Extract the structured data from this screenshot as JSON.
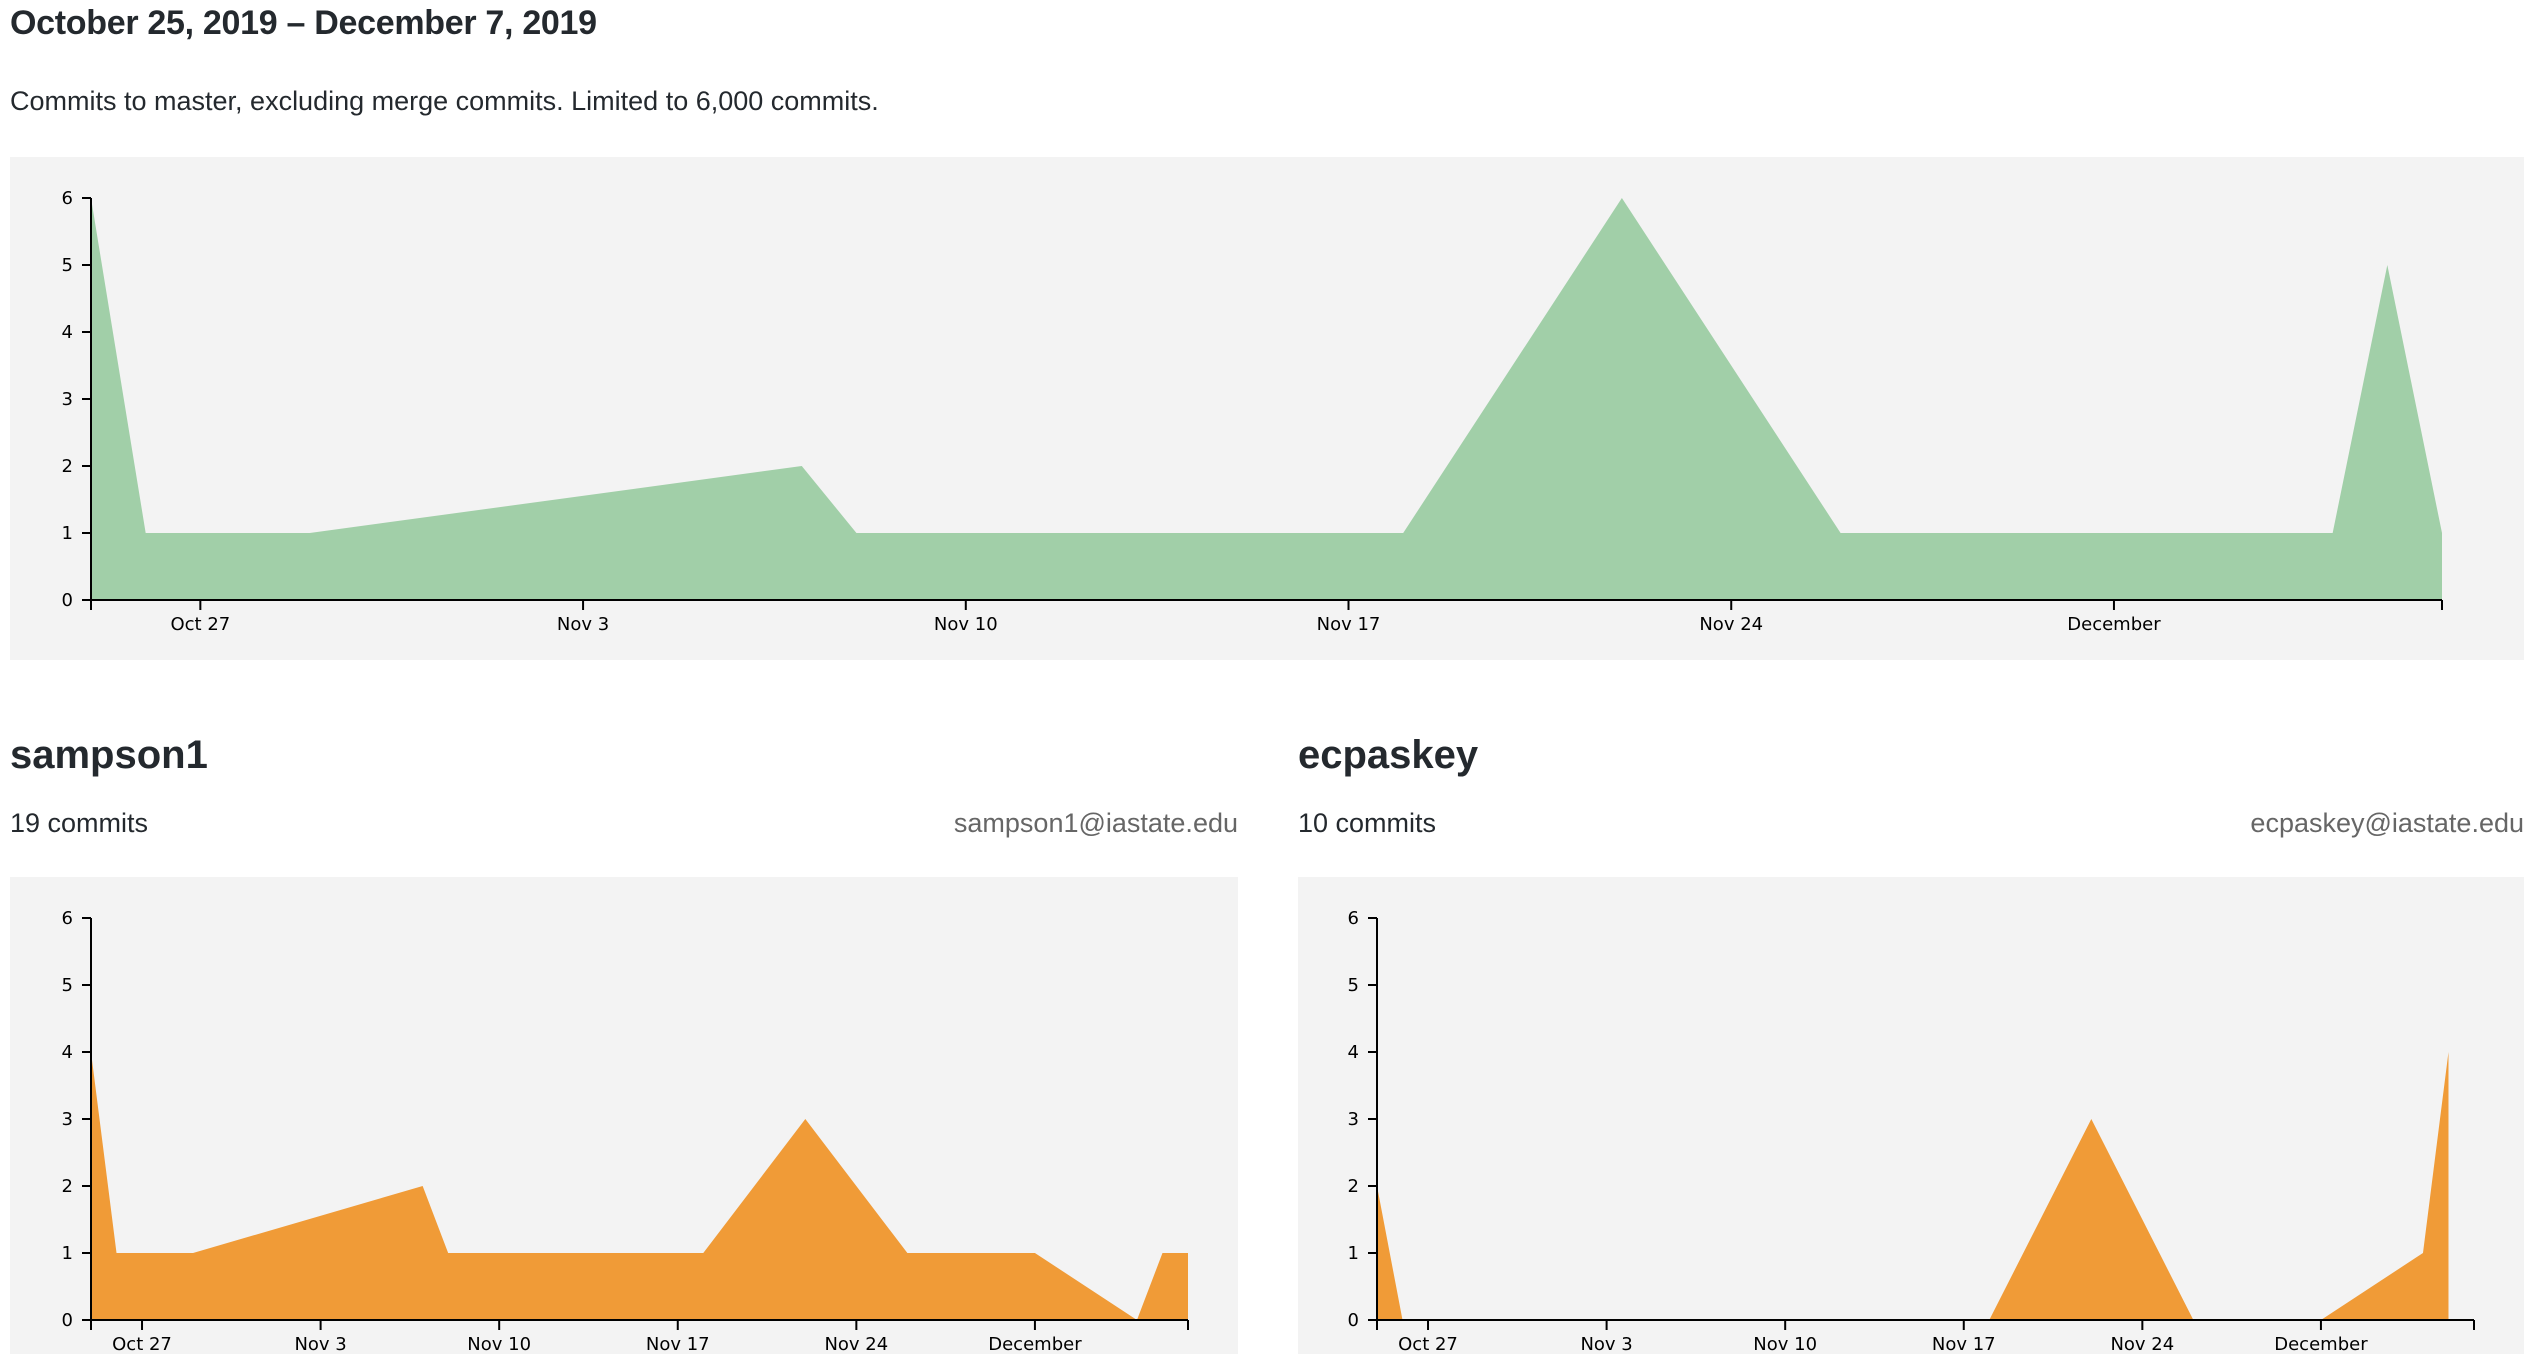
{
  "header": {
    "range_title": "October 25, 2019 – December 7, 2019",
    "description": "Commits to master, excluding merge commits. Limited to 6,000 commits."
  },
  "colors": {
    "main_area": "#a1cfa8",
    "contributor_area": "#f09b37",
    "panel_bg": "#f3f3f3",
    "email": "#666666"
  },
  "contributors": [
    {
      "name": "sampson1",
      "commits": "19 commits",
      "email": "sampson1@iastate.edu"
    },
    {
      "name": "ecpaskey",
      "commits": "10 commits",
      "email": "ecpaskey@iastate.edu"
    }
  ],
  "chart_data": [
    {
      "type": "area",
      "title": "",
      "x_tick_labels": [
        "Oct 27",
        "Nov 3",
        "Nov 10",
        "Nov 17",
        "Nov 24",
        "December"
      ],
      "x_tick_dates": [
        "2019-10-27",
        "2019-11-03",
        "2019-11-10",
        "2019-11-17",
        "2019-11-24",
        "2019-12-01"
      ],
      "xlim": [
        "2019-10-25",
        "2019-12-07"
      ],
      "ylim": [
        0,
        6
      ],
      "y_ticks": [
        0,
        1,
        2,
        3,
        4,
        5,
        6
      ],
      "grid": false,
      "series": [
        {
          "x": [
            "2019-10-25",
            "2019-10-26",
            "2019-10-29",
            "2019-11-07",
            "2019-11-08",
            "2019-11-18",
            "2019-11-22",
            "2019-11-26",
            "2019-12-05",
            "2019-12-06",
            "2019-12-07"
          ],
          "y": [
            6,
            1,
            1,
            2,
            1,
            1,
            6,
            1,
            1,
            5,
            1
          ]
        }
      ]
    },
    {
      "type": "area",
      "title": "",
      "x_tick_labels": [
        "Oct 27",
        "Nov 3",
        "Nov 10",
        "Nov 17",
        "Nov 24",
        "December"
      ],
      "x_tick_dates": [
        "2019-10-27",
        "2019-11-03",
        "2019-11-10",
        "2019-11-17",
        "2019-11-24",
        "2019-12-01"
      ],
      "xlim": [
        "2019-10-25",
        "2019-12-07"
      ],
      "ylim": [
        0,
        6
      ],
      "y_ticks": [
        0,
        1,
        2,
        3,
        4,
        5,
        6
      ],
      "grid": false,
      "series": [
        {
          "x": [
            "2019-10-25",
            "2019-10-26",
            "2019-10-29",
            "2019-11-07",
            "2019-11-08",
            "2019-11-18",
            "2019-11-22",
            "2019-11-26",
            "2019-12-01",
            "2019-12-05",
            "2019-12-06",
            "2019-12-07"
          ],
          "y": [
            4,
            1,
            1,
            2,
            1,
            1,
            3,
            1,
            1,
            0,
            1,
            1
          ]
        }
      ]
    },
    {
      "type": "area",
      "title": "",
      "x_tick_labels": [
        "Oct 27",
        "Nov 3",
        "Nov 10",
        "Nov 17",
        "Nov 24",
        "December"
      ],
      "x_tick_dates": [
        "2019-10-27",
        "2019-11-03",
        "2019-11-10",
        "2019-11-17",
        "2019-11-24",
        "2019-12-01"
      ],
      "xlim": [
        "2019-10-25",
        "2019-12-07"
      ],
      "ylim": [
        0,
        6
      ],
      "y_ticks": [
        0,
        1,
        2,
        3,
        4,
        5,
        6
      ],
      "grid": false,
      "series": [
        {
          "x": [
            "2019-10-25",
            "2019-10-26",
            "2019-11-18",
            "2019-11-22",
            "2019-11-26",
            "2019-12-01",
            "2019-12-05",
            "2019-12-06"
          ],
          "y": [
            2,
            0,
            0,
            3,
            0,
            0,
            1,
            4
          ]
        }
      ]
    }
  ]
}
